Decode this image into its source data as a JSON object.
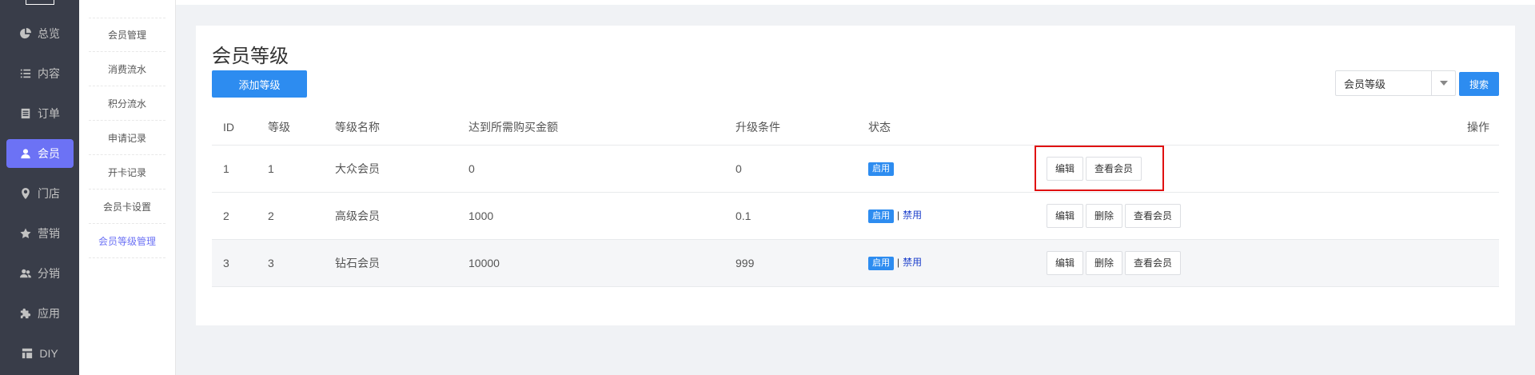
{
  "sidebar": {
    "items": [
      {
        "label": "总览",
        "icon": "pie-chart-icon"
      },
      {
        "label": "内容",
        "icon": "list-icon"
      },
      {
        "label": "订单",
        "icon": "order-doc-icon"
      },
      {
        "label": "会员",
        "icon": "user-icon",
        "active": true
      },
      {
        "label": "门店",
        "icon": "map-pin-icon"
      },
      {
        "label": "营销",
        "icon": "star-icon"
      },
      {
        "label": "分销",
        "icon": "users-icon"
      },
      {
        "label": "应用",
        "icon": "puzzle-icon"
      },
      {
        "label": "DIY",
        "icon": "layout-icon"
      }
    ],
    "active_color": "#6c72f5"
  },
  "subnav": {
    "items": [
      "会员管理",
      "消费流水",
      "积分流水",
      "申请记录",
      "开卡记录",
      "会员卡设置",
      "会员等级管理"
    ]
  },
  "main": {
    "title": "会员等级",
    "add_button": "添加等级",
    "search_select": "会员等级",
    "search_button": "搜索",
    "table": {
      "headers": [
        "ID",
        "等级",
        "等级名称",
        "达到所需购买金额",
        "升级条件",
        "状态",
        "操作"
      ],
      "rows": [
        {
          "id": "1",
          "level": "1",
          "name": "大众会员",
          "amount": "0",
          "condition": "0",
          "status": "启用",
          "ban": "",
          "actions": [
            "编辑",
            "查看会员"
          ]
        },
        {
          "id": "2",
          "level": "2",
          "name": "高级会员",
          "amount": "1000",
          "condition": "0.1",
          "status": "启用",
          "ban": "禁用",
          "actions": [
            "编辑",
            "删除",
            "查看会员"
          ]
        },
        {
          "id": "3",
          "level": "3",
          "name": "钻石会员",
          "amount": "10000",
          "condition": "999",
          "status": "启用",
          "ban": "禁用",
          "actions": [
            "编辑",
            "删除",
            "查看会员"
          ]
        }
      ]
    }
  },
  "colors": {
    "primary": "#2d8cf0",
    "sidebar_bg": "#393d49",
    "highlight": "#e01010"
  }
}
